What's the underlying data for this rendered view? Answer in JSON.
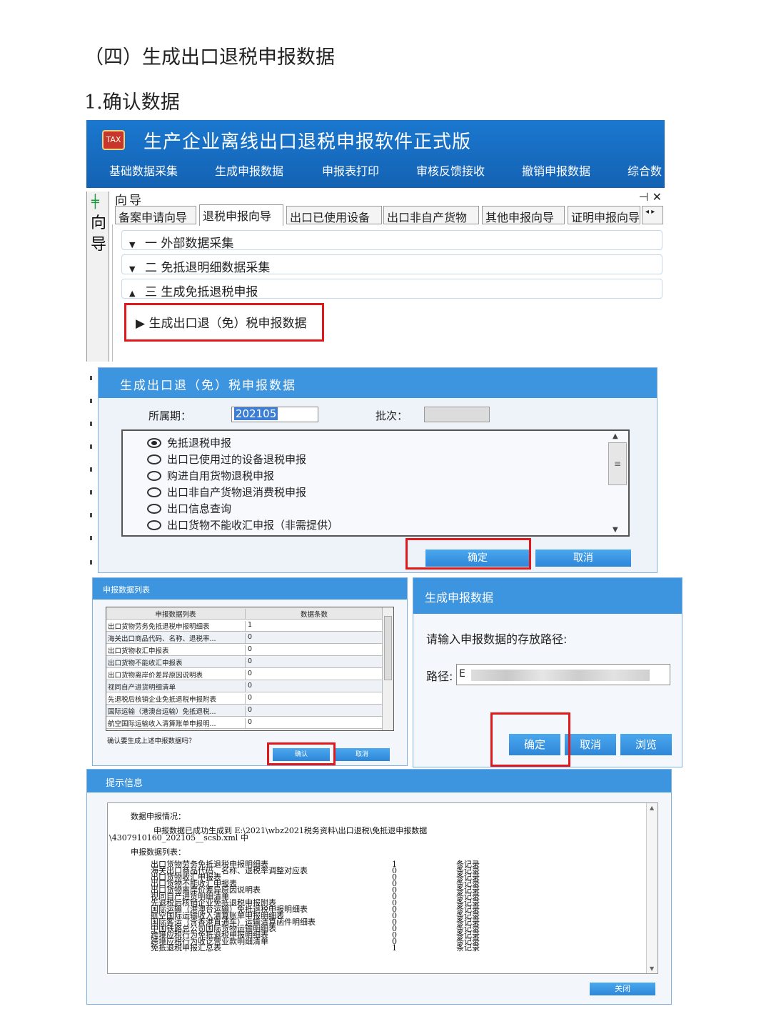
{
  "doc": {
    "section_heading": "（四）生成出口退税申报数据",
    "step_heading": "1.确认数据"
  },
  "main_window": {
    "title": "生产企业离线出口退税申报软件正式版",
    "logo_text": "TAX",
    "menu": [
      "基础数据采集",
      "生成申报数据",
      "申报表打印",
      "审核反馈接收",
      "撤销申报数据",
      "综合数"
    ],
    "side_tab_label": "向导",
    "guide_title": "向导",
    "guide_controls": "⊣ ✕",
    "tabs": [
      "备案申请向导",
      "退税申报向导",
      "出口已使用设备",
      "出口非自产货物",
      "其他申报向导",
      "证明申报向导"
    ],
    "tab_nav": "◂ ▸",
    "accordion": [
      {
        "arrow": "▼",
        "label": "一  外部数据采集"
      },
      {
        "arrow": "▼",
        "label": "二  免抵退明细数据采集"
      },
      {
        "arrow": "▲",
        "label": "三  生成免抵退税申报"
      }
    ],
    "sub_item": {
      "arrow": "▶",
      "label": "生成出口退（免）税申报数据"
    }
  },
  "generate_dialog": {
    "title": "生成出口退（免）税申报数据",
    "period_label": "所属期：",
    "period_value": "202105",
    "batch_label": "批次：",
    "options": [
      {
        "label": "免抵退税申报",
        "selected": true
      },
      {
        "label": "出口已使用过的设备退税申报",
        "selected": false
      },
      {
        "label": "购进自用货物退税申报",
        "selected": false
      },
      {
        "label": "出口非自产货物退消费税申报",
        "selected": false
      },
      {
        "label": "出口信息查询",
        "selected": false
      },
      {
        "label": "出口货物不能收汇申报（非需提供）",
        "selected": false
      }
    ],
    "ok": "确定",
    "cancel": "取消"
  },
  "data_list": {
    "title": "申报数据列表",
    "col_name": "申报数据列表",
    "col_count": "数据条数",
    "rows": [
      {
        "name": "出口货物劳务免抵退税申报明细表",
        "count": "1"
      },
      {
        "name": "海关出口商品代码、名称、退税率...",
        "count": "0"
      },
      {
        "name": "出口货物收汇申报表",
        "count": "0"
      },
      {
        "name": "出口货物不能收汇申报表",
        "count": "0"
      },
      {
        "name": "出口货物离岸价差异原因说明表",
        "count": "0"
      },
      {
        "name": "视同自产进货明细清单",
        "count": "0"
      },
      {
        "name": "先退税后核销企业免抵退税申报附表",
        "count": "0"
      },
      {
        "name": "国际运输（港澳台运输）免抵退税...",
        "count": "0"
      },
      {
        "name": "航空国际运输收入清算账单申报明...",
        "count": "0"
      }
    ],
    "question": "确认要生成上述申报数据吗？",
    "confirm": "确认",
    "cancel": "取消"
  },
  "path_dialog": {
    "title": "生成申报数据",
    "prompt": "请输入申报数据的存放路径:",
    "path_label": "路径:",
    "path_value": "E",
    "ok": "确定",
    "cancel": "取消",
    "browse": "浏览"
  },
  "info_dialog": {
    "title": "提示信息",
    "summary_label": "数据申报情况：",
    "success_line1": "申报数据已成功生成到 E:\\2021\\wbz2021税务资料\\出口退税\\免抵退申报数据",
    "success_line2": "\\4307910160_202105__scsb.xml 中",
    "list_label": "申报数据列表：",
    "unit": "条记录",
    "rows": [
      {
        "name": "出口货物劳务免抵退税申报明细表",
        "count": "1"
      },
      {
        "name": "海关出口商品代码、名称、退税率调整对应表",
        "count": "0"
      },
      {
        "name": "出口货物收汇申报表",
        "count": "0"
      },
      {
        "name": "出口货物不能收汇申报表",
        "count": "0"
      },
      {
        "name": "出口货物离岸价差异原因说明表",
        "count": "0"
      },
      {
        "name": "视同自产进货明细清单",
        "count": "0"
      },
      {
        "name": "先退税后核销企业免抵退税申报附表",
        "count": "0"
      },
      {
        "name": "国际运输（港澳台运输）免抵退税申报明细表",
        "count": "0"
      },
      {
        "name": "航空国际运输收入清算账单申报明细表",
        "count": "0"
      },
      {
        "name": "国际客运（含香港直通车）运输清算函件明细表",
        "count": "0"
      },
      {
        "name": "中国铁路总公司国际货物运输明细表",
        "count": "0"
      },
      {
        "name": "跨境应税行为免抵退税申报明细表",
        "count": "0"
      },
      {
        "name": "跨境应税行为收讫营业款明细清单",
        "count": "0"
      },
      {
        "name": "免抵退税申报汇总表",
        "count": "1"
      }
    ],
    "close": "关闭"
  }
}
